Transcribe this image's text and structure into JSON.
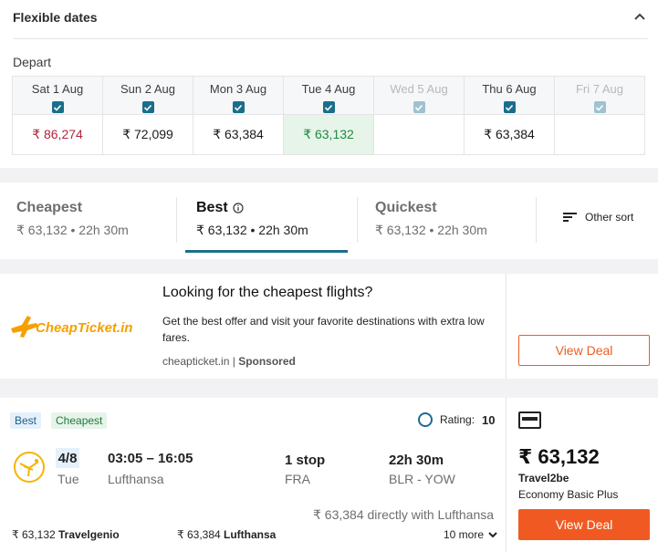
{
  "flexible_dates": {
    "title": "Flexible dates",
    "depart_label": "Depart",
    "dates": [
      {
        "label": "Sat 1 Aug",
        "price": "₹ 86,274",
        "checked": true,
        "state": "red"
      },
      {
        "label": "Sun 2 Aug",
        "price": "₹ 72,099",
        "checked": true,
        "state": "normal"
      },
      {
        "label": "Mon 3 Aug",
        "price": "₹ 63,384",
        "checked": true,
        "state": "normal"
      },
      {
        "label": "Tue 4 Aug",
        "price": "₹ 63,132",
        "checked": true,
        "state": "green"
      },
      {
        "label": "Wed 5 Aug",
        "price": "",
        "checked": true,
        "state": "disabled"
      },
      {
        "label": "Thu 6 Aug",
        "price": "₹ 63,384",
        "checked": true,
        "state": "normal"
      },
      {
        "label": "Fri 7 Aug",
        "price": "",
        "checked": true,
        "state": "disabled"
      }
    ]
  },
  "sort_tabs": {
    "cheapest": {
      "label": "Cheapest",
      "sub": "₹ 63,132 • 22h 30m"
    },
    "best": {
      "label": "Best",
      "sub": "₹ 63,132 • 22h 30m"
    },
    "quickest": {
      "label": "Quickest",
      "sub": "₹ 63,132 • 22h 30m"
    },
    "other_sort": "Other sort",
    "active": "best"
  },
  "ad": {
    "logo_text": "CheapTicket.in",
    "title": "Looking for the cheapest flights?",
    "description": "Get the best offer and visit your favorite destinations with extra low fares.",
    "source": "cheapticket.in",
    "sponsored": "Sponsored",
    "button": "View Deal"
  },
  "result": {
    "badges": [
      "Best",
      "Cheapest"
    ],
    "rating_label": "Rating:",
    "rating_value": "10",
    "date": "4/8",
    "day": "Tue",
    "times": "03:05 – 16:05",
    "airline": "Lufthansa",
    "stops": "1 stop",
    "via": "FRA",
    "duration": "22h 30m",
    "route": "BLR - YOW",
    "direct_note": "₹ 63,384 directly with Lufthansa",
    "offers": [
      {
        "price": "₹ 63,132",
        "provider": "Travelgenio"
      },
      {
        "price": "₹ 63,384",
        "provider": "Lufthansa"
      }
    ],
    "more": "10 more",
    "price": "₹ 63,132",
    "price_provider": "Travel2be",
    "cabin": "Economy Basic Plus",
    "button": "View Deal"
  },
  "colors": {
    "accent": "#1a6e8c",
    "cta": "#f05a22",
    "price_low": "#1f8a3d",
    "price_high": "#b4233b"
  }
}
